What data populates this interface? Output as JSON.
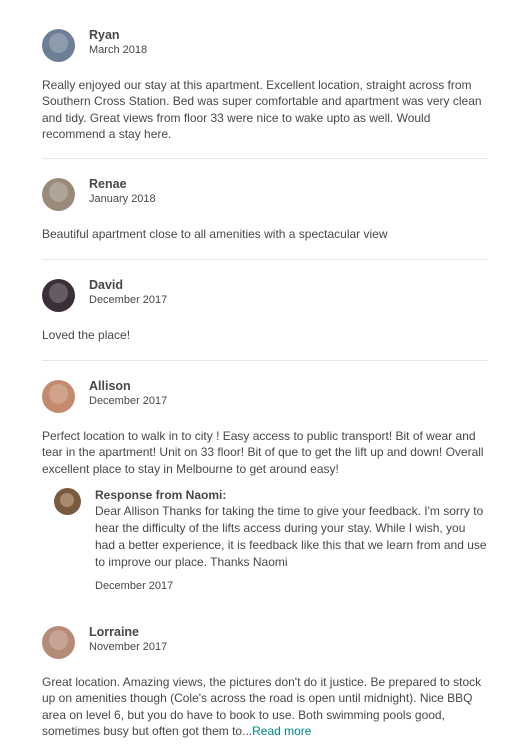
{
  "reviews": [
    {
      "name": "Ryan",
      "date": "March 2018",
      "text": "Really enjoyed our stay at this apartment. Excellent location, straight across from Southern Cross Station. Bed was super comfortable and apartment was very clean and tidy. Great views from floor 33 were nice to wake upto as well. Would recommend a stay here.",
      "avatar_color": "#6d7f96"
    },
    {
      "name": "Renae",
      "date": "January 2018",
      "text": "Beautiful apartment close to all amenities with a spectacular view",
      "avatar_color": "#9a8a7a"
    },
    {
      "name": "David",
      "date": "December 2017",
      "text": "Loved the place!",
      "avatar_color": "#3a2f38"
    },
    {
      "name": "Allison",
      "date": "December 2017",
      "text": "Perfect location to walk in to city ! Easy access to public transport! Bit of wear and tear in the apartment! Unit on 33 floor! Bit of que to get the lift up and down! Overall excellent place to stay in Melbourne to get around easy!",
      "avatar_color": "#c48a6e",
      "response": {
        "title": "Response from Naomi:",
        "text": "Dear Allison Thanks for taking the time to give your feedback. I'm sorry to hear the difficulty of the lifts access during your stay. While I wish, you had a better experience, it is feedback like this that we learn from and use to improve our place. Thanks Naomi",
        "date": "December 2017"
      }
    },
    {
      "name": "Lorraine",
      "date": "November 2017",
      "text": "Great location. Amazing views, the pictures don't do it justice. Be prepared to stock up on amenities though (Cole's across the road is open until midnight). Nice BBQ area on level 6, but you do have to book to use. Both swimming pools good, sometimes busy but often got them to...",
      "read_more": "Read more",
      "avatar_color": "#b58b78"
    }
  ],
  "colors": {
    "link": "#008489",
    "text": "#484848",
    "divider": "#e6e6e6"
  }
}
